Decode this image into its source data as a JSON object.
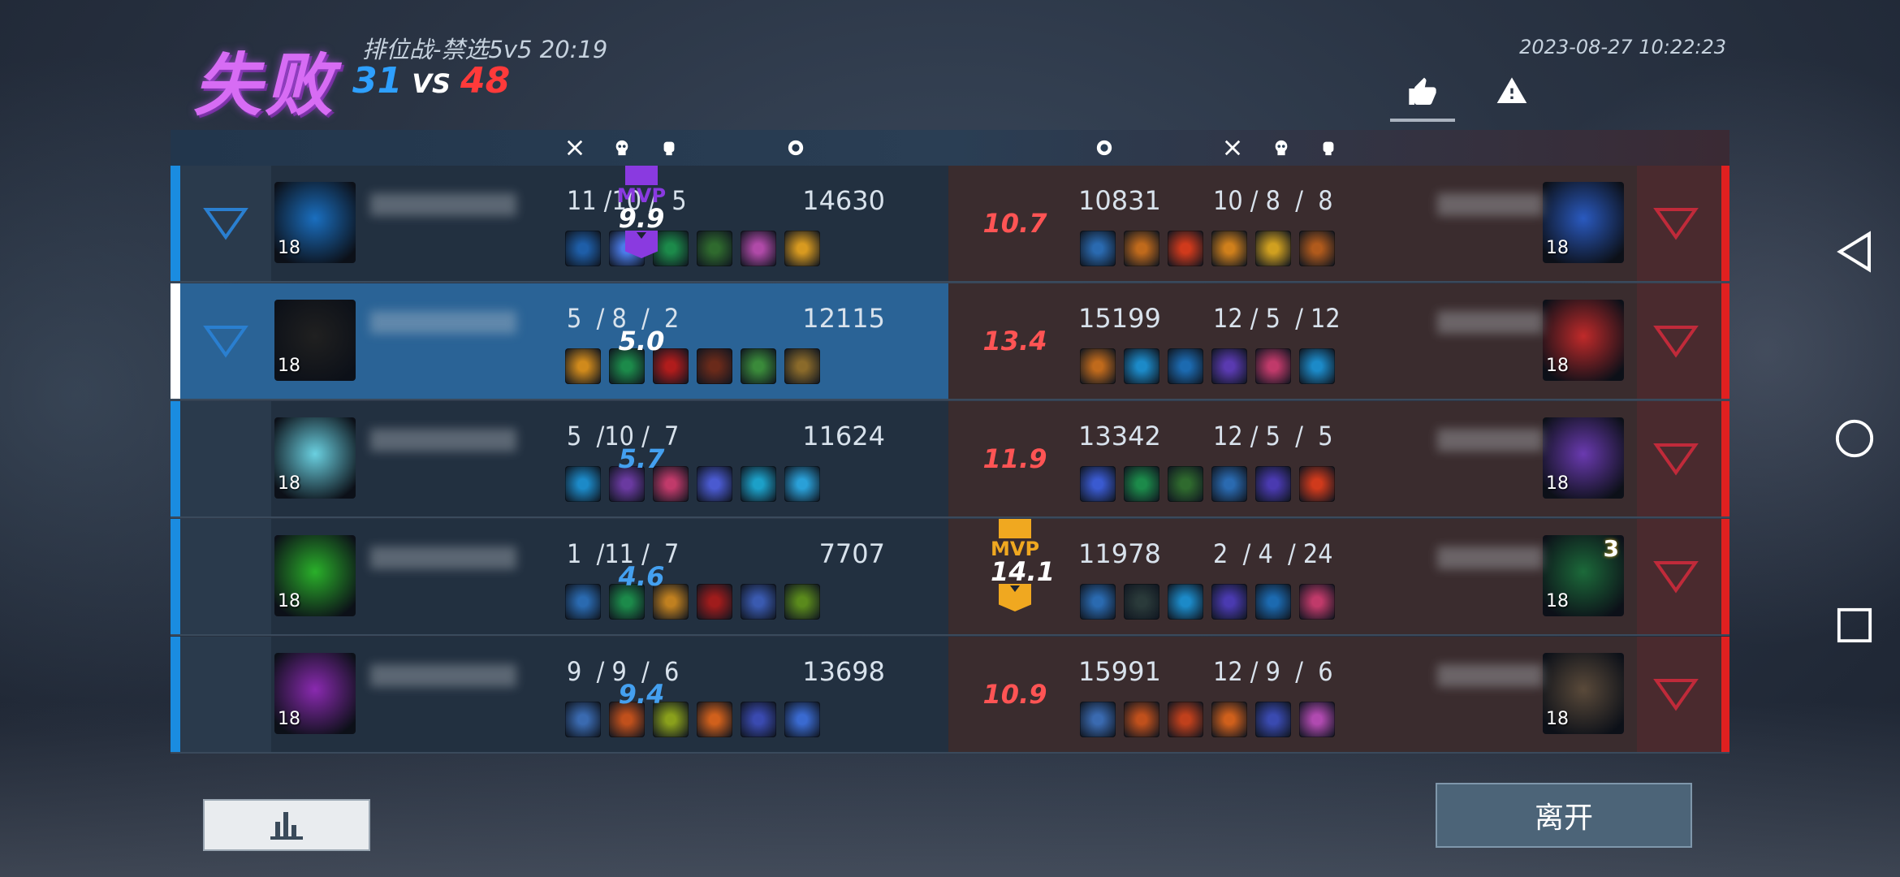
{
  "header": {
    "result": "失败",
    "mode_and_time": "排位战-禁选5v5  20:19",
    "score_blue": "31",
    "score_vs": "VS",
    "score_red": "48",
    "datetime": "2023-08-27 10:22:23",
    "icons": {
      "like": "thumbs-up-icon",
      "report": "warning-icon"
    }
  },
  "columns": {
    "icons": [
      "sword-icon",
      "skull-icon",
      "fist-icon",
      "coin-icon"
    ]
  },
  "blue_team": [
    {
      "level": "18",
      "kda": "11 /10 /  5",
      "damage": "14630",
      "items": [
        "#1e5ea8",
        "#4a7be8",
        "#1c8a4a",
        "#2f6a2e",
        "#b04aa8",
        "#d89a20"
      ],
      "rating": "9.9",
      "mvp": true,
      "portrait": "#1a6fc0"
    },
    {
      "level": "18",
      "kda": "5  / 8  /  2",
      "damage": "12115",
      "items": [
        "#d08a1c",
        "#1c8a4a",
        "#b01c1c",
        "#6a2a1a",
        "#3a8a3a",
        "#8a6a2a"
      ],
      "rating": "5.0",
      "mvp": false,
      "portrait": "#202020"
    },
    {
      "level": "18",
      "kda": "5  /10 /  7",
      "damage": "11624",
      "items": [
        "#1c8ac8",
        "#6a3aa0",
        "#c03a6a",
        "#4a5ad0",
        "#1ca0c8",
        "#2aa0d8"
      ],
      "rating": "5.7",
      "mvp": false,
      "portrait": "#6ad0e0"
    },
    {
      "level": "18",
      "kda": "1  /11 /  7",
      "damage": "7707",
      "items": [
        "#2a6ab0",
        "#1c8a4a",
        "#c08020",
        "#a01c1c",
        "#3a5ab0",
        "#5a8a1c"
      ],
      "rating": "4.6",
      "mvp": false,
      "portrait": "#2ab02a"
    },
    {
      "level": "18",
      "kda": "9  / 9  /  6",
      "damage": "13698",
      "items": [
        "#3a6ab0",
        "#c0501c",
        "#8aa01c",
        "#d0601c",
        "#3a4ab0",
        "#3a6ad0"
      ],
      "rating": "9.4",
      "mvp": false,
      "portrait": "#8a2ab0"
    }
  ],
  "red_team": [
    {
      "level": "18",
      "kda": "10 / 8  /  8",
      "damage": "10831",
      "items": [
        "#2a6ab0",
        "#c06a1c",
        "#d03a1c",
        "#d0801c",
        "#d0a020",
        "#b05a1c"
      ],
      "rating": "10.7",
      "mvp": false,
      "portrait": "#2a5ac0",
      "badge": ""
    },
    {
      "level": "18",
      "kda": "12 / 5  / 12",
      "damage": "15199",
      "items": [
        "#c06a1c",
        "#1c8ac8",
        "#1c6ab0",
        "#5a3ab0",
        "#c03a6a",
        "#1c8ac8"
      ],
      "rating": "13.4",
      "mvp": false,
      "portrait": "#c02a2a",
      "badge": ""
    },
    {
      "level": "18",
      "kda": "12 / 5  /  5",
      "damage": "13342",
      "items": [
        "#3a5ad0",
        "#1c8a4a",
        "#2f6a2e",
        "#2a6ab0",
        "#4a3ab0",
        "#d03a1c"
      ],
      "rating": "11.9",
      "mvp": false,
      "portrait": "#6a3ab0",
      "badge": ""
    },
    {
      "level": "18",
      "kda": "2  / 4  / 24",
      "damage": "11978",
      "items": [
        "#2a6ab0",
        "#2a3a3a",
        "#1c8ac8",
        "#4a3ab0",
        "#1c6ab0",
        "#c03a6a"
      ],
      "rating": "14.1",
      "mvp": true,
      "portrait": "#1c6a3a",
      "badge": "3"
    },
    {
      "level": "18",
      "kda": "12 / 9  /  6",
      "damage": "15991",
      "items": [
        "#3a6ab0",
        "#c0501c",
        "#c0401c",
        "#d0601c",
        "#3a4ab0",
        "#b04ab0"
      ],
      "rating": "10.9",
      "mvp": false,
      "portrait": "#5a4a3a",
      "badge": ""
    }
  ],
  "mvp_label": "MVP",
  "footer": {
    "stats_icon": "bar-chart-icon",
    "leave_label": "离开"
  },
  "nav": {
    "back": "back-icon",
    "home": "home-icon",
    "recents": "recents-icon"
  },
  "colors": {
    "blue": "#1a8ce0",
    "red": "#e02020",
    "mvp_blue": "#8a3ae0",
    "mvp_red": "#f0a820"
  }
}
